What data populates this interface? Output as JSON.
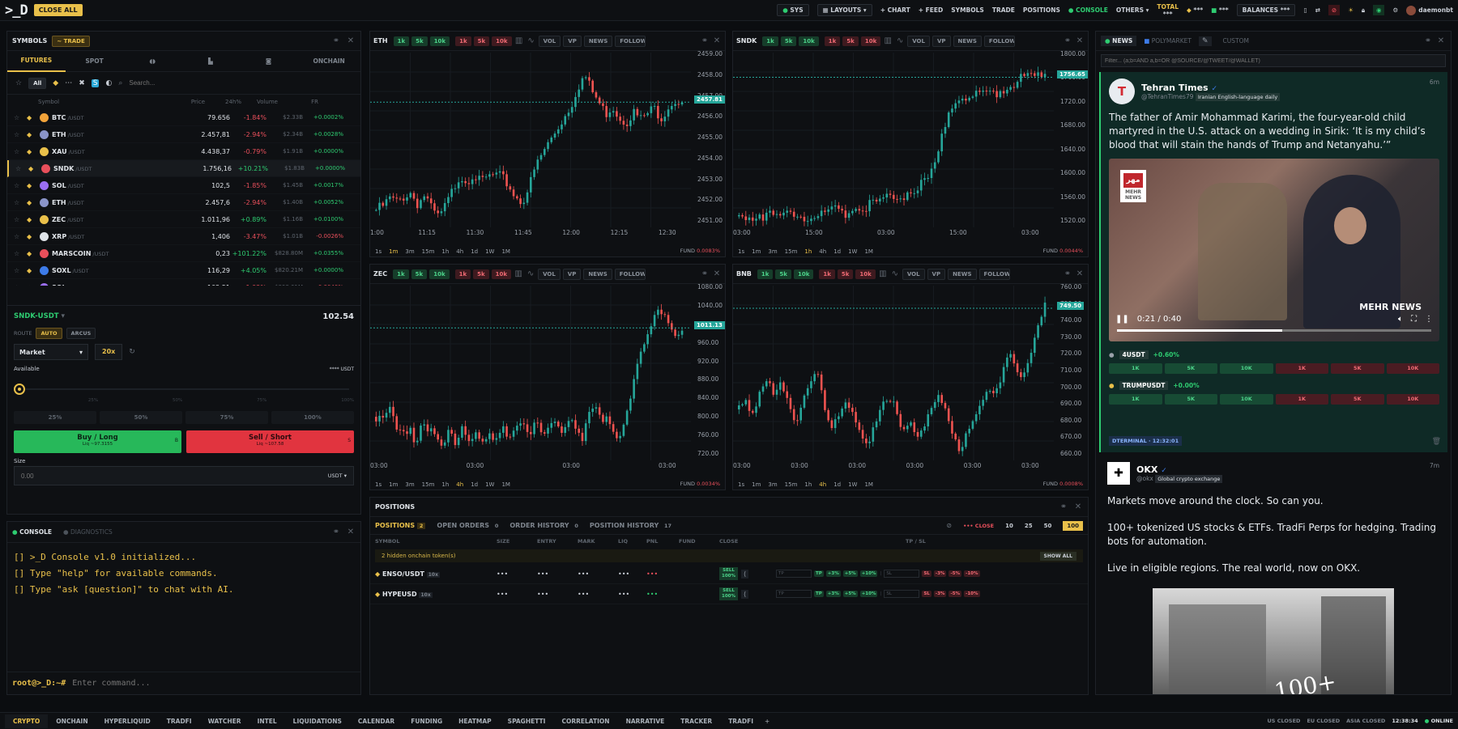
{
  "top": {
    "logo": ">_D",
    "close_all": "CLOSE ALL",
    "sys": "SYS",
    "layouts": "LAYOUTS",
    "chart": "+ CHART",
    "feed": "+ FEED",
    "symbols": "SYMBOLS",
    "trade": "TRADE",
    "positions": "POSITIONS",
    "console": "CONSOLE",
    "others": "OTHERS",
    "total_label": "TOTAL",
    "total_value": "***",
    "bal1": "***",
    "bal2": "***",
    "balances": "BALANCES ***",
    "user": "daemonbt"
  },
  "symbols": {
    "title": "SYMBOLS",
    "trade_btn": "~ TRADE",
    "tabs": [
      "FUTURES",
      "SPOT",
      "ONCHAIN"
    ],
    "filter_all": "All",
    "search_placeholder": "Search...",
    "cols": {
      "symbol": "Symbol",
      "price": "Price",
      "change": "24h%",
      "volume": "Volume",
      "fr": "FR"
    },
    "rows": [
      {
        "name": "BTC",
        "quote": "/USDT",
        "price": "79.656",
        "change": "-1.84%",
        "vol": "$2.33B",
        "fr": "+0.0002%",
        "up": false,
        "color": "#f2a33a"
      },
      {
        "name": "ETH",
        "quote": "/USDT",
        "price": "2.457,81",
        "change": "-2.94%",
        "vol": "$2.34B",
        "fr": "+0.0028%",
        "up": false,
        "color": "#8a94c8"
      },
      {
        "name": "XAU",
        "quote": "/USDT",
        "price": "4.438,37",
        "change": "-0.79%",
        "vol": "$1.91B",
        "fr": "+0.0000%",
        "up": false,
        "color": "#e9c04a"
      },
      {
        "name": "SNDK",
        "quote": "/USDT",
        "price": "1.756,16",
        "change": "+10.21%",
        "vol": "$1.83B",
        "fr": "+0.0000%",
        "up": true,
        "color": "#e84f5b"
      },
      {
        "name": "SOL",
        "quote": "/USDT",
        "price": "102,5",
        "change": "-1.85%",
        "vol": "$1.45B",
        "fr": "+0.0017%",
        "up": false,
        "color": "#9b6ef3"
      },
      {
        "name": "ETH",
        "quote": "/USDT",
        "price": "2.457,6",
        "change": "-2.94%",
        "vol": "$1.40B",
        "fr": "+0.0052%",
        "up": false,
        "color": "#8a94c8"
      },
      {
        "name": "ZEC",
        "quote": "/USDT",
        "price": "1.011,96",
        "change": "+0.89%",
        "vol": "$1.16B",
        "fr": "+0.0100%",
        "up": true,
        "color": "#e9c04a"
      },
      {
        "name": "XRP",
        "quote": "/USDT",
        "price": "1,406",
        "change": "-3.47%",
        "vol": "$1.01B",
        "fr": "-0.0026%",
        "up": false,
        "color": "#dfe3e8"
      },
      {
        "name": "MARSCOIN",
        "quote": "/USDT",
        "price": "0,23",
        "change": "+101.22%",
        "vol": "$828.80M",
        "fr": "+0.0355%",
        "up": true,
        "color": "#e84f5b"
      },
      {
        "name": "SOXL",
        "quote": "/USDT",
        "price": "116,29",
        "change": "+4.05%",
        "vol": "$820.21M",
        "fr": "+0.0000%",
        "up": true,
        "color": "#3d7be8"
      },
      {
        "name": "SOL",
        "quote": "/USDT",
        "price": "102,51",
        "change": "-1.92%",
        "vol": "$808.61M",
        "fr": "-0.0040%",
        "up": false,
        "color": "#9b6ef3"
      }
    ]
  },
  "trade": {
    "pair": "SNDK-USDT",
    "price": "102.54",
    "route_label": "ROUTE",
    "route_auto": "AUTO",
    "route_arcus": "ARCUS",
    "order_type": "Market",
    "leverage": "20x",
    "available": "Available",
    "available_val": "**** USDT",
    "pct": [
      "25%",
      "50%",
      "75%",
      "100%"
    ],
    "buy": "Buy / Long",
    "buy_liq": "Liq ~97.3155",
    "sell": "Sell / Short",
    "sell_liq": "Liq ~107.58",
    "size_label": "Size",
    "size_placeholder": "0.00",
    "size_unit": "USDT"
  },
  "console": {
    "tab1": "CONSOLE",
    "tab2": "DIAGNOSTICS",
    "lines": [
      ">_D Console v1.0 initialized...",
      "Type \"help\" for available commands.",
      "Type \"ask [question]\" to chat with AI."
    ],
    "prompt": "root@>_D:~#",
    "placeholder": "Enter command..."
  },
  "chart_btns": {
    "b1": "1k",
    "b2": "5k",
    "b3": "10k",
    "vol": "VOL",
    "vp": "VP",
    "news": "NEWS",
    "follow": "FOLLOW"
  },
  "timeframes": [
    "1s",
    "1m",
    "3m",
    "15m",
    "1h",
    "4h",
    "1d",
    "1W",
    "1M"
  ],
  "charts": [
    {
      "symbol": "ETH",
      "price_label": "2457.81",
      "fund": "FUND",
      "fund_val": "0.0083%",
      "ticks": [
        "2459.00",
        "2458.00",
        "2457.00",
        "2456.00",
        "2455.00",
        "2454.00",
        "2453.00",
        "2452.00",
        "2451.00"
      ],
      "xlabels": [
        "1:00",
        "11:15",
        "11:30",
        "11:45",
        "12:00",
        "12:15",
        "12:30"
      ],
      "active_tf": "1m"
    },
    {
      "symbol": "SNDK",
      "price_label": "1756.65",
      "fund": "FUND",
      "fund_val": "0.0044%",
      "ticks": [
        "1800.00",
        "1760.00",
        "1720.00",
        "1680.00",
        "1640.00",
        "1600.00",
        "1560.00",
        "1520.00"
      ],
      "xlabels": [
        "03:00",
        "15:00",
        "03:00",
        "15:00",
        "03:00"
      ],
      "active_tf": "1h"
    },
    {
      "symbol": "ZEC",
      "price_label": "1011.13",
      "fund": "FUND",
      "fund_val": "0.0034%",
      "ticks": [
        "1080.00",
        "1040.00",
        "1000.00",
        "960.00",
        "920.00",
        "880.00",
        "840.00",
        "800.00",
        "760.00",
        "720.00"
      ],
      "xlabels": [
        "03:00",
        "03:00",
        "03:00",
        "03:00"
      ],
      "active_tf": "4h"
    },
    {
      "symbol": "BNB",
      "price_label": "749.50",
      "fund": "FUND",
      "fund_val": "0.0008%",
      "ticks": [
        "760.00",
        "750.00",
        "740.00",
        "730.00",
        "720.00",
        "710.00",
        "700.00",
        "690.00",
        "680.00",
        "670.00",
        "660.00"
      ],
      "xlabels": [
        "03:00",
        "03:00",
        "03:00",
        "03:00",
        "03:00",
        "03:00"
      ],
      "active_tf": "4h"
    }
  ],
  "positions": {
    "title": "POSITIONS",
    "tabs": [
      {
        "label": "POSITIONS",
        "count": "2"
      },
      {
        "label": "OPEN ORDERS",
        "count": "0"
      },
      {
        "label": "ORDER HISTORY",
        "count": "0"
      },
      {
        "label": "POSITION HISTORY",
        "count": "17"
      }
    ],
    "close_label": "CLOSE",
    "qty": [
      "10",
      "25",
      "50",
      "100"
    ],
    "cols": [
      "SYMBOL",
      "SIZE",
      "ENTRY",
      "MARK",
      "LIQ",
      "PNL",
      "FUND",
      "CLOSE",
      "TP / SL"
    ],
    "hidden": "2 hidden onchain token(s)",
    "show_all": "SHOW ALL",
    "rows": [
      {
        "symbol": "ENSO/USDT",
        "lev": "10x"
      },
      {
        "symbol": "HYPEUSD",
        "lev": "10x"
      }
    ],
    "mask": "•••",
    "sell": "SELL",
    "sell_pct": "100%",
    "tp": "TP",
    "sl": "SL",
    "tp_opts": [
      "+3%",
      "+5%",
      "+10%"
    ],
    "sl_opts": [
      "-3%",
      "-5%",
      "-10%"
    ]
  },
  "news": {
    "tabs": [
      "NEWS",
      "POLYMARKET",
      "CUSTOM"
    ],
    "filter_placeholder": "Filter... (a;b=AND a,b=OR @SOURCE/@TWEET/@WALLET)",
    "item1": {
      "source": "Tehran Times",
      "handle": "@TehranTimes79",
      "badge": "Iranian English-language daily",
      "time": "6m",
      "text": "The father of Amir Mohammad Karimi, the four-year-old child martyred in the U.S. attack on a wedding in Sirik: ‘It is my child’s blood that will stain the hands of Trump and Netanyahu.’”",
      "video_time": "0:21 / 0:40",
      "video_brand": "MEHR NEWS",
      "tickers": [
        {
          "name": "4USDT",
          "change": "+0.60%"
        },
        {
          "name": "TRUMPUSDT",
          "change": "+0.00%"
        }
      ],
      "btns": [
        "1K",
        "5K",
        "10K",
        "1K",
        "5K",
        "10K"
      ],
      "footer": "DTERMINAL · 12:32:01"
    },
    "item2": {
      "source": "OKX",
      "handle": "@okx",
      "badge": "Global crypto exchange",
      "time": "7m",
      "p1": "Markets move around the clock. So can you.",
      "p2": "100+ tokenized US stocks & ETFs. TradFi Perps for hedging. Trading bots for automation.",
      "p3": "Live in eligible regions. The real world, now on OKX.",
      "img_text": "100+"
    }
  },
  "bottom": {
    "tabs": [
      "CRYPTO",
      "ONCHAIN",
      "HYPERLIQUID",
      "TRADFI",
      "WATCHER",
      "INTEL",
      "LIQUIDATIONS",
      "CALENDAR",
      "FUNDING",
      "HEATMAP",
      "SPAGHETTI",
      "CORRELATION",
      "NARRATIVE",
      "TRACKER",
      "TRADFI"
    ],
    "us": "US CLOSED",
    "eu": "EU CLOSED",
    "asia": "ASIA CLOSED",
    "clock": "12:38:34",
    "online": "ONLINE"
  }
}
